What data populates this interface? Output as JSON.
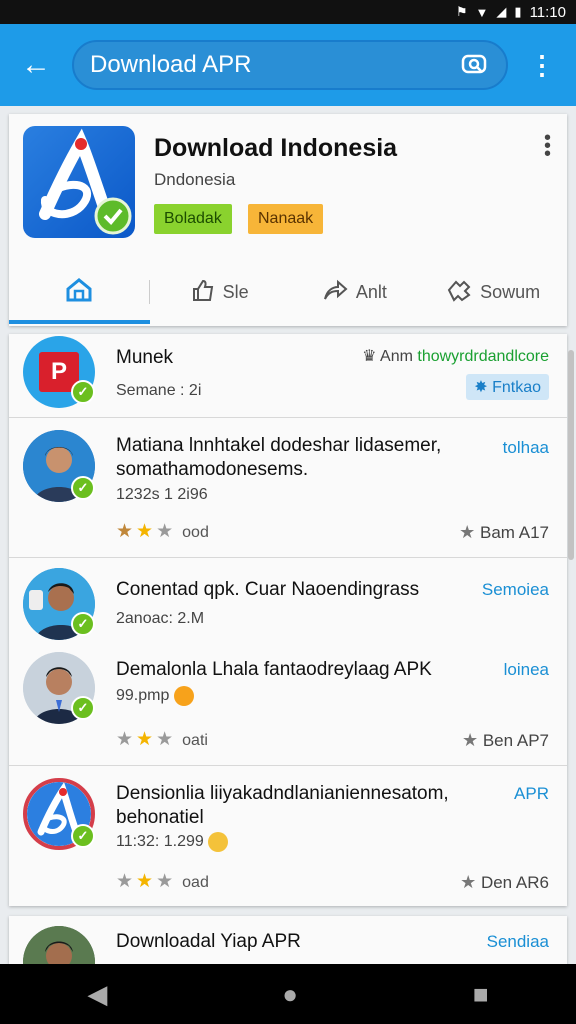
{
  "status_bar": {
    "time": "11:10"
  },
  "search": {
    "query": "Download APR"
  },
  "app": {
    "title": "Download Indonesia",
    "subtitle": "Dndonesia",
    "badge_green": "Boladak",
    "badge_orange": "Nanaak"
  },
  "tabs": [
    {
      "label": ""
    },
    {
      "label": "Sle"
    },
    {
      "label": "Anlt"
    },
    {
      "label": "Sowum"
    }
  ],
  "rows": [
    {
      "title": "Munek",
      "meta": "Semane : 2i",
      "right_label": "Anm",
      "right_link": "thowyrdrdandlcore",
      "chip": "Fntkao"
    },
    {
      "title": "Matiana lnnhtakel dodeshar lidasemer, somathamodonesems.",
      "meta": "1232s 1 2i96",
      "link": "tolhaa",
      "stars_label": "ood",
      "rate_label": "Bam A17"
    },
    {
      "title": "Conentad qpk. Cuar Naoendingrass",
      "meta": "2anoac: 2.M",
      "link": "Semoiea"
    },
    {
      "title": "Demalonla Lhala fantaodreylaag APK",
      "meta": "99.pmp",
      "link": "loinea",
      "stars_label": "oati",
      "rate_label": "Ben AP7"
    },
    {
      "title": "Densionlia liiyakadndlanianiennesatom, behonatiel",
      "meta": "11:32: 1.299",
      "link": "APR",
      "stars_label": "oad",
      "rate_label": "Den AR6"
    },
    {
      "title": "Downloadal Yiap APR",
      "link": "Sendiaa"
    }
  ],
  "colors": {
    "appbar": "#1e9be8",
    "accent": "#1a8fd4",
    "verified": "#6bbf1f"
  }
}
